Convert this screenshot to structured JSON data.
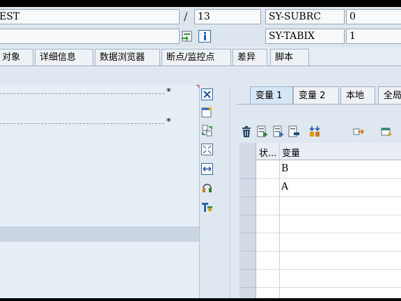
{
  "header": {
    "program_field": "EST",
    "separator": "/",
    "line_field": "13",
    "sysvar1_label": "SY-SUBRC",
    "sysvar1_value": "0",
    "sysvar2_label": "SY-TABIX",
    "sysvar2_value": "1"
  },
  "tabs": [
    {
      "label": "对象"
    },
    {
      "label": "详细信息"
    },
    {
      "label": "数据浏览器"
    },
    {
      "label": "断点/监控点"
    },
    {
      "label": "差异"
    },
    {
      "label": "脚本"
    }
  ],
  "code_area": {
    "line1_marker": "*",
    "line2_marker": "*"
  },
  "right_panel": {
    "tabs": [
      {
        "label": "变量 1"
      },
      {
        "label": "变量 2"
      },
      {
        "label": "本地"
      },
      {
        "label": "全局"
      }
    ],
    "columns": {
      "status": "状...",
      "variable": "变量"
    },
    "rows": [
      {
        "variable": "B"
      },
      {
        "variable": "A"
      }
    ]
  },
  "colors": {
    "panel_bg": "#dfe8f1",
    "selection_row": "#c9d5e1",
    "active_tab": "#d6e6f6",
    "field_bg": "#f7f9fb"
  }
}
